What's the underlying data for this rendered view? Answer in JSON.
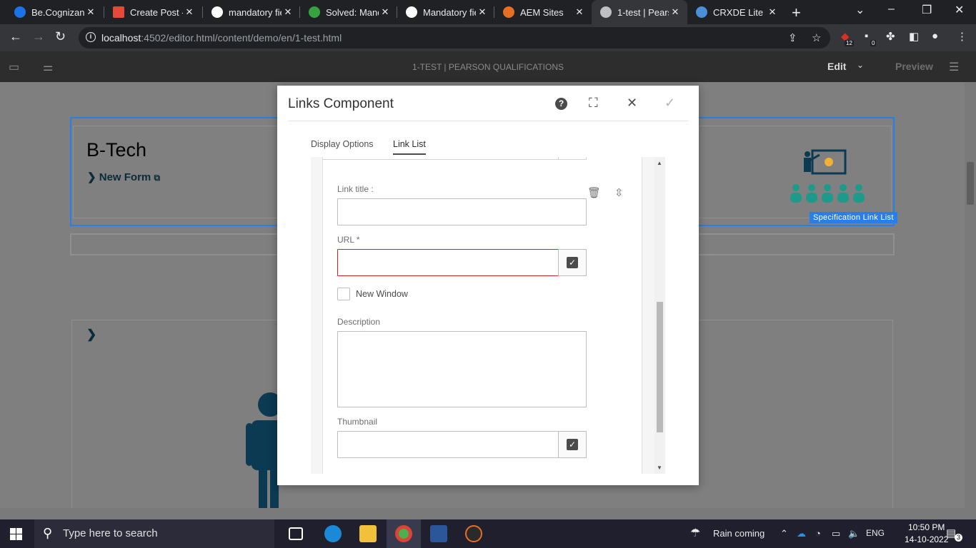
{
  "browser": {
    "tabs": [
      {
        "title": "Be.Cognizant",
        "color": "#1a73e8",
        "active": false
      },
      {
        "title": "Create Post -",
        "color": "#e34a3a",
        "active": false
      },
      {
        "title": "mandatory fie",
        "color": "#ffffff",
        "active": false
      },
      {
        "title": "Solved: Mand",
        "color": "#37a13f",
        "active": false
      },
      {
        "title": "Mandatory fie",
        "color": "#ffffff",
        "active": false
      },
      {
        "title": "AEM Sites",
        "color": "#e76f24",
        "active": false
      },
      {
        "title": "1-test | Pearso",
        "color": "#bdc1c6",
        "active": true
      },
      {
        "title": "CRXDE Lite",
        "color": "#4a90d9",
        "active": false
      }
    ],
    "url_host": "localhost",
    "url_rest": ":4502/editor.html/content/demo/en/1-test.html",
    "extension_badges": [
      "12",
      "0"
    ]
  },
  "editor": {
    "page_title": "1-TEST | PEARSON QUALIFICATIONS",
    "mode": "Edit",
    "preview": "Preview"
  },
  "page": {
    "heading": "B-Tech",
    "link": "New Form",
    "component_label": "Specification Link List",
    "arrow": "›"
  },
  "dialog": {
    "title": "Links Component",
    "tabs": [
      "Display Options",
      "Link List"
    ],
    "active_tab": "Link List",
    "fields": {
      "link_title_label": "Link title :",
      "link_title_value": "",
      "url_label": "URL *",
      "url_value": "",
      "new_window_label": "New Window",
      "new_window_checked": false,
      "description_label": "Description",
      "description_value": "",
      "thumbnail_label": "Thumbnail",
      "thumbnail_value": ""
    }
  },
  "taskbar": {
    "search_placeholder": "Type here to search",
    "weather": "Rain coming",
    "language": "ENG",
    "time": "10:50 PM",
    "date": "14-10-2022",
    "notifications": "3"
  },
  "colors": {
    "accent_blue": "#2680eb",
    "error_red": "#c9252d",
    "chrome_dark": "#202124"
  }
}
